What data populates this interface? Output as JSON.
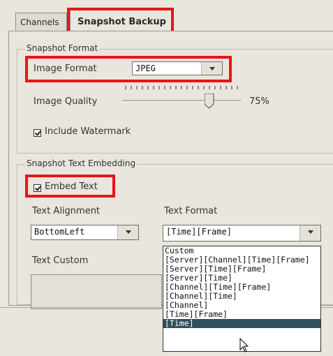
{
  "tabs": [
    {
      "label": "Channels",
      "selected": false
    },
    {
      "label": "Snapshot Backup",
      "selected": true
    }
  ],
  "snapshot_format": {
    "legend": "Snapshot Format",
    "image_format_label": "Image Format",
    "image_format_value": "JPEG",
    "image_quality_label": "Image Quality",
    "image_quality_value": "75%",
    "image_quality_fraction": 0.75,
    "include_watermark_label": "Include Watermark",
    "include_watermark_checked": true
  },
  "text_embedding": {
    "legend": "Snapshot Text Embedding",
    "embed_text_label": "Embed Text",
    "embed_text_checked": true,
    "text_alignment_label": "Text Alignment",
    "text_alignment_value": "BottomLeft",
    "text_format_label": "Text Format",
    "text_format_value": "[Time][Frame]",
    "text_custom_label": "Text Custom"
  },
  "text_format_options": [
    "Custom",
    "[Server][Channel][Time][Frame]",
    "[Server][Time][Frame]",
    "[Server][Time]",
    "[Channel][Time][Frame]",
    "[Channel][Time]",
    "[Channel]",
    "[Time][Frame]",
    "[Time]"
  ],
  "text_format_highlighted": "[Time]",
  "highlight_color": "#e8141b"
}
